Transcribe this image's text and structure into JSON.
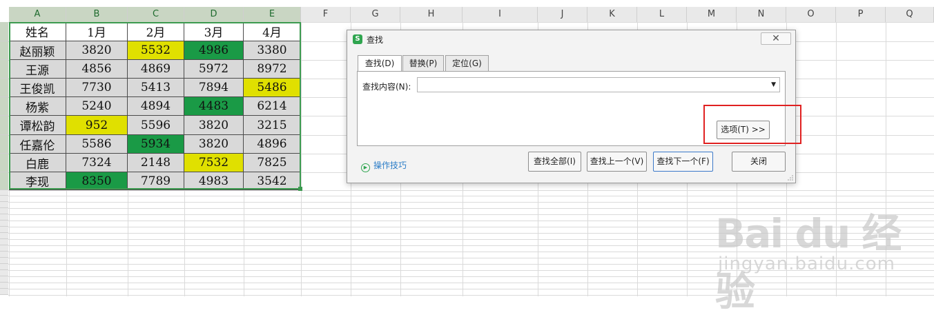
{
  "spreadsheet": {
    "columns": [
      "A",
      "B",
      "C",
      "D",
      "E",
      "F",
      "G",
      "H",
      "I",
      "J",
      "K",
      "L",
      "M",
      "N",
      "O",
      "P",
      "Q"
    ],
    "table": {
      "header": [
        "姓名",
        "1月",
        "2月",
        "3月",
        "4月"
      ],
      "rows": [
        {
          "name": "赵丽颖",
          "values": [
            "3820",
            "5532",
            "4986",
            "3380"
          ],
          "fills": [
            "",
            "yellow",
            "green",
            ""
          ]
        },
        {
          "name": "王源",
          "values": [
            "4856",
            "4869",
            "5972",
            "8972"
          ],
          "fills": [
            "",
            "",
            "",
            ""
          ]
        },
        {
          "name": "王俊凯",
          "values": [
            "7730",
            "5413",
            "7894",
            "5486"
          ],
          "fills": [
            "",
            "",
            "",
            "yellow"
          ]
        },
        {
          "name": "杨紫",
          "values": [
            "5240",
            "4894",
            "4483",
            "6214"
          ],
          "fills": [
            "",
            "",
            "green",
            ""
          ]
        },
        {
          "name": "谭松韵",
          "values": [
            "952",
            "5596",
            "3820",
            "3215"
          ],
          "fills": [
            "yellow",
            "",
            "",
            ""
          ]
        },
        {
          "name": "任嘉伦",
          "values": [
            "5586",
            "5934",
            "3820",
            "4896"
          ],
          "fills": [
            "",
            "green",
            "",
            ""
          ]
        },
        {
          "name": "白鹿",
          "values": [
            "7324",
            "2148",
            "7532",
            "7825"
          ],
          "fills": [
            "",
            "",
            "yellow",
            ""
          ]
        },
        {
          "name": "李现",
          "values": [
            "8350",
            "7789",
            "4983",
            "3542"
          ],
          "fills": [
            "green",
            "",
            "",
            ""
          ]
        }
      ]
    },
    "colors": {
      "yellow": "#e0e000",
      "green": "#1a9a46",
      "selection": "#3b9a4f"
    }
  },
  "dialog": {
    "title": "查找",
    "close_icon": "✕",
    "tabs": [
      "查找(D)",
      "替换(P)",
      "定位(G)"
    ],
    "active_tab": 0,
    "find_label": "查找内容(N):",
    "find_value": "",
    "dropdown_icon": "▼",
    "options_button": "选项(T) >>",
    "tips_label": "操作技巧",
    "buttons": {
      "find_all": "查找全部(I)",
      "find_prev": "查找上一个(V)",
      "find_next": "查找下一个(F)",
      "close": "关闭"
    },
    "highlight_color": "#e02020"
  },
  "watermark": {
    "logo_text": "Bai du 经验",
    "url": "jingyan.baidu.com"
  }
}
